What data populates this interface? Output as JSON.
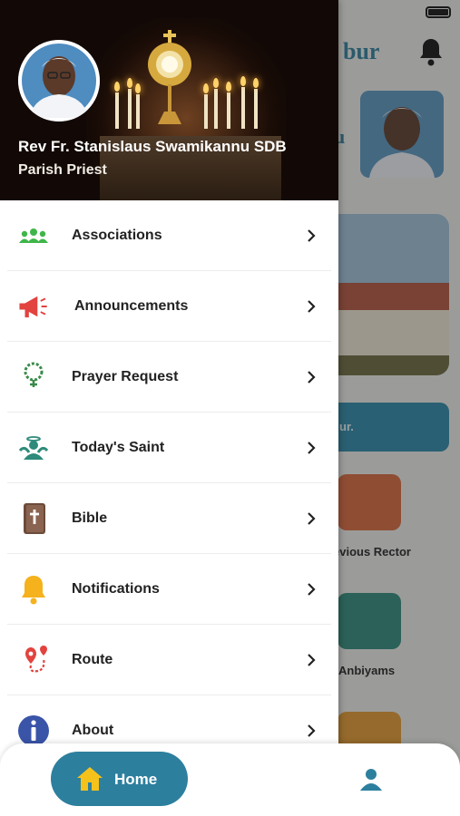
{
  "background": {
    "title_partial": "bur",
    "subtitle_partial": "u",
    "banner_partial": "ur.",
    "tiles": [
      {
        "label_partial": "evious Rector",
        "color": "#d9683c"
      },
      {
        "label_partial": "Anbiyams",
        "color": "#2e8a7a"
      },
      {
        "label_partial": "",
        "color": "#e39a2f"
      }
    ]
  },
  "drawer": {
    "priest_name": "Rev Fr. Stanislaus Swamikannu SDB",
    "priest_role": "Parish Priest",
    "menu": [
      {
        "label": "Associations",
        "icon": "people-group-icon"
      },
      {
        "label": "Announcements",
        "icon": "megaphone-icon"
      },
      {
        "label": "Prayer Request",
        "icon": "rosary-icon"
      },
      {
        "label": "Today's Saint",
        "icon": "saint-icon"
      },
      {
        "label": "Bible",
        "icon": "bible-icon"
      },
      {
        "label": "Notifications",
        "icon": "bell-icon"
      },
      {
        "label": "Route",
        "icon": "route-pin-icon"
      },
      {
        "label": "About",
        "icon": "info-icon"
      }
    ]
  },
  "bottom_nav": {
    "home_label": "Home",
    "accent": "#2d7f9e"
  }
}
